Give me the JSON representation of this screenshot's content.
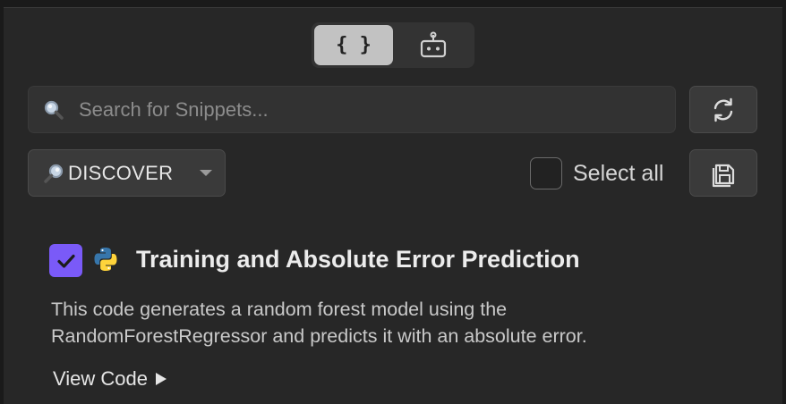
{
  "toolbar": {
    "code_toggle_label": "{ }",
    "code_toggle_icon": "code-braces-icon",
    "bot_toggle_icon": "robot-icon"
  },
  "search": {
    "placeholder": "Search for Snippets...",
    "value": "",
    "icon": "magnifier-icon",
    "refresh_icon": "refresh-icon"
  },
  "filter": {
    "discover_label": "DISCOVER",
    "discover_icon": "magnifier-icon",
    "select_all_label": "Select all",
    "select_all_checked": false,
    "save_icon": "save-icon"
  },
  "snippet": {
    "checked": true,
    "language_icon": "python-icon",
    "title": "Training and Absolute Error Prediction",
    "description": "This code generates a random forest model using the RandomForestRegressor and predicts it with an absolute error.",
    "view_code_label": "View Code"
  },
  "colors": {
    "accent": "#7a5af8",
    "background": "#272727",
    "python_blue": "#3776ab",
    "python_yellow": "#ffd43b"
  }
}
